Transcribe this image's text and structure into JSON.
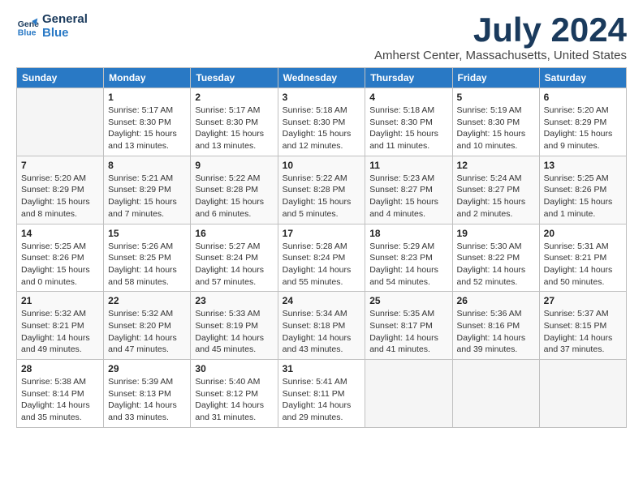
{
  "logo": {
    "line1": "General",
    "line2": "Blue"
  },
  "title": "July 2024",
  "location": "Amherst Center, Massachusetts, United States",
  "days_of_week": [
    "Sunday",
    "Monday",
    "Tuesday",
    "Wednesday",
    "Thursday",
    "Friday",
    "Saturday"
  ],
  "weeks": [
    [
      {
        "day": "",
        "info": ""
      },
      {
        "day": "1",
        "info": "Sunrise: 5:17 AM\nSunset: 8:30 PM\nDaylight: 15 hours\nand 13 minutes."
      },
      {
        "day": "2",
        "info": "Sunrise: 5:17 AM\nSunset: 8:30 PM\nDaylight: 15 hours\nand 13 minutes."
      },
      {
        "day": "3",
        "info": "Sunrise: 5:18 AM\nSunset: 8:30 PM\nDaylight: 15 hours\nand 12 minutes."
      },
      {
        "day": "4",
        "info": "Sunrise: 5:18 AM\nSunset: 8:30 PM\nDaylight: 15 hours\nand 11 minutes."
      },
      {
        "day": "5",
        "info": "Sunrise: 5:19 AM\nSunset: 8:30 PM\nDaylight: 15 hours\nand 10 minutes."
      },
      {
        "day": "6",
        "info": "Sunrise: 5:20 AM\nSunset: 8:29 PM\nDaylight: 15 hours\nand 9 minutes."
      }
    ],
    [
      {
        "day": "7",
        "info": "Sunrise: 5:20 AM\nSunset: 8:29 PM\nDaylight: 15 hours\nand 8 minutes."
      },
      {
        "day": "8",
        "info": "Sunrise: 5:21 AM\nSunset: 8:29 PM\nDaylight: 15 hours\nand 7 minutes."
      },
      {
        "day": "9",
        "info": "Sunrise: 5:22 AM\nSunset: 8:28 PM\nDaylight: 15 hours\nand 6 minutes."
      },
      {
        "day": "10",
        "info": "Sunrise: 5:22 AM\nSunset: 8:28 PM\nDaylight: 15 hours\nand 5 minutes."
      },
      {
        "day": "11",
        "info": "Sunrise: 5:23 AM\nSunset: 8:27 PM\nDaylight: 15 hours\nand 4 minutes."
      },
      {
        "day": "12",
        "info": "Sunrise: 5:24 AM\nSunset: 8:27 PM\nDaylight: 15 hours\nand 2 minutes."
      },
      {
        "day": "13",
        "info": "Sunrise: 5:25 AM\nSunset: 8:26 PM\nDaylight: 15 hours\nand 1 minute."
      }
    ],
    [
      {
        "day": "14",
        "info": "Sunrise: 5:25 AM\nSunset: 8:26 PM\nDaylight: 15 hours\nand 0 minutes."
      },
      {
        "day": "15",
        "info": "Sunrise: 5:26 AM\nSunset: 8:25 PM\nDaylight: 14 hours\nand 58 minutes."
      },
      {
        "day": "16",
        "info": "Sunrise: 5:27 AM\nSunset: 8:24 PM\nDaylight: 14 hours\nand 57 minutes."
      },
      {
        "day": "17",
        "info": "Sunrise: 5:28 AM\nSunset: 8:24 PM\nDaylight: 14 hours\nand 55 minutes."
      },
      {
        "day": "18",
        "info": "Sunrise: 5:29 AM\nSunset: 8:23 PM\nDaylight: 14 hours\nand 54 minutes."
      },
      {
        "day": "19",
        "info": "Sunrise: 5:30 AM\nSunset: 8:22 PM\nDaylight: 14 hours\nand 52 minutes."
      },
      {
        "day": "20",
        "info": "Sunrise: 5:31 AM\nSunset: 8:21 PM\nDaylight: 14 hours\nand 50 minutes."
      }
    ],
    [
      {
        "day": "21",
        "info": "Sunrise: 5:32 AM\nSunset: 8:21 PM\nDaylight: 14 hours\nand 49 minutes."
      },
      {
        "day": "22",
        "info": "Sunrise: 5:32 AM\nSunset: 8:20 PM\nDaylight: 14 hours\nand 47 minutes."
      },
      {
        "day": "23",
        "info": "Sunrise: 5:33 AM\nSunset: 8:19 PM\nDaylight: 14 hours\nand 45 minutes."
      },
      {
        "day": "24",
        "info": "Sunrise: 5:34 AM\nSunset: 8:18 PM\nDaylight: 14 hours\nand 43 minutes."
      },
      {
        "day": "25",
        "info": "Sunrise: 5:35 AM\nSunset: 8:17 PM\nDaylight: 14 hours\nand 41 minutes."
      },
      {
        "day": "26",
        "info": "Sunrise: 5:36 AM\nSunset: 8:16 PM\nDaylight: 14 hours\nand 39 minutes."
      },
      {
        "day": "27",
        "info": "Sunrise: 5:37 AM\nSunset: 8:15 PM\nDaylight: 14 hours\nand 37 minutes."
      }
    ],
    [
      {
        "day": "28",
        "info": "Sunrise: 5:38 AM\nSunset: 8:14 PM\nDaylight: 14 hours\nand 35 minutes."
      },
      {
        "day": "29",
        "info": "Sunrise: 5:39 AM\nSunset: 8:13 PM\nDaylight: 14 hours\nand 33 minutes."
      },
      {
        "day": "30",
        "info": "Sunrise: 5:40 AM\nSunset: 8:12 PM\nDaylight: 14 hours\nand 31 minutes."
      },
      {
        "day": "31",
        "info": "Sunrise: 5:41 AM\nSunset: 8:11 PM\nDaylight: 14 hours\nand 29 minutes."
      },
      {
        "day": "",
        "info": ""
      },
      {
        "day": "",
        "info": ""
      },
      {
        "day": "",
        "info": ""
      }
    ]
  ]
}
